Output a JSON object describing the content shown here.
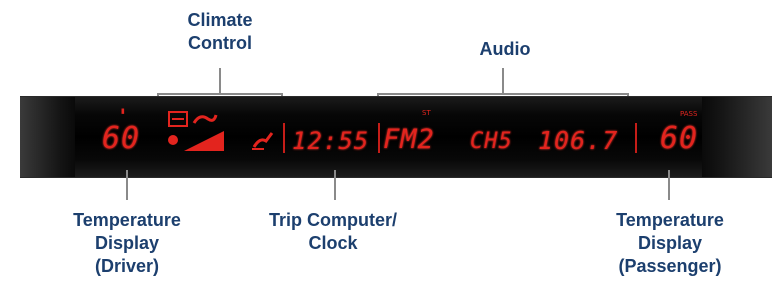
{
  "labels": {
    "climate_control": "Climate\nControl",
    "audio": "Audio",
    "temp_driver": "Temperature\nDisplay\n(Driver)",
    "trip_clock": "Trip Computer/\nClock",
    "temp_passenger": "Temperature\nDisplay\n(Passenger)"
  },
  "display": {
    "temp_driver": "60",
    "clock": "12:55",
    "band": "FM2",
    "channel": "CH5",
    "frequency": "106.7",
    "temp_passenger": "60",
    "small_indicator": "PASS"
  },
  "colors": {
    "label": "#1c3f6e",
    "lcd": "#e3241e",
    "leader": "#8a8a8a"
  },
  "icons": [
    "fan-icon",
    "airflow-icon",
    "fan-speed-bar-icon",
    "seat-airflow-icon"
  ]
}
